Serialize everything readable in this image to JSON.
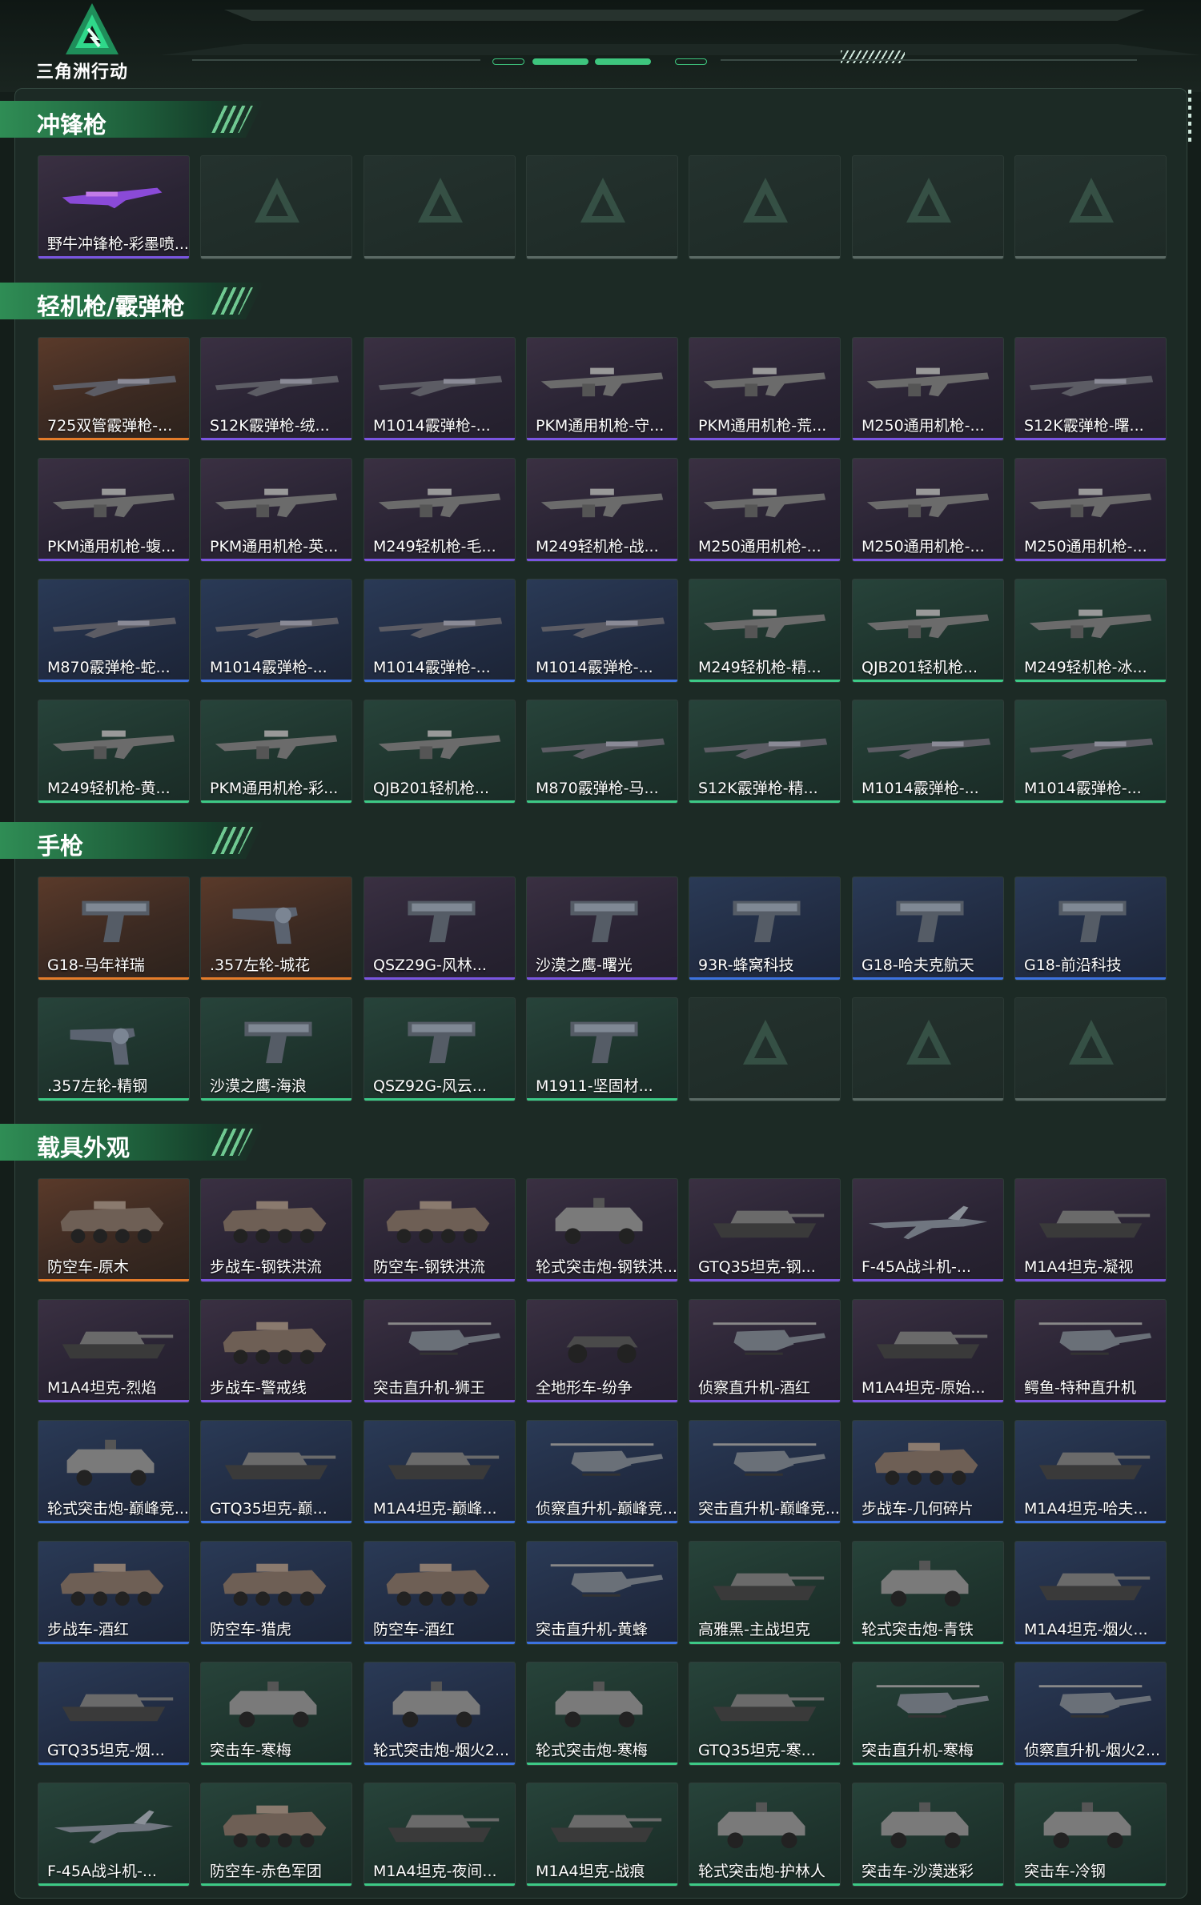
{
  "logo": {
    "text": "三角洲行动"
  },
  "sections": [
    {
      "title": "冲锋枪",
      "items": [
        {
          "label": "野牛冲锋枪-彩墨喷...",
          "rarity": "purple",
          "icon": "smg-icon"
        },
        {
          "label": "",
          "rarity": "empty"
        },
        {
          "label": "",
          "rarity": "empty"
        },
        {
          "label": "",
          "rarity": "empty"
        },
        {
          "label": "",
          "rarity": "empty"
        },
        {
          "label": "",
          "rarity": "empty"
        },
        {
          "label": "",
          "rarity": "empty"
        }
      ]
    },
    {
      "title": "轻机枪/霰弹枪",
      "items": [
        {
          "label": "725双管霰弹枪-...",
          "rarity": "orange",
          "icon": "shotgun-icon"
        },
        {
          "label": "S12K霰弹枪-绒...",
          "rarity": "purple",
          "icon": "shotgun-icon"
        },
        {
          "label": "M1014霰弹枪-...",
          "rarity": "purple",
          "icon": "shotgun-icon"
        },
        {
          "label": "PKM通用机枪-守...",
          "rarity": "purple",
          "icon": "lmg-icon"
        },
        {
          "label": "PKM通用机枪-荒...",
          "rarity": "purple",
          "icon": "lmg-icon"
        },
        {
          "label": "M250通用机枪-...",
          "rarity": "purple",
          "icon": "lmg-icon"
        },
        {
          "label": "S12K霰弹枪-曙...",
          "rarity": "purple",
          "icon": "shotgun-icon"
        },
        {
          "label": "PKM通用机枪-蝮...",
          "rarity": "purple",
          "icon": "lmg-icon"
        },
        {
          "label": "PKM通用机枪-英...",
          "rarity": "purple",
          "icon": "lmg-icon"
        },
        {
          "label": "M249轻机枪-毛...",
          "rarity": "purple",
          "icon": "lmg-icon"
        },
        {
          "label": "M249轻机枪-战...",
          "rarity": "purple",
          "icon": "lmg-icon"
        },
        {
          "label": "M250通用机枪-...",
          "rarity": "purple",
          "icon": "lmg-icon"
        },
        {
          "label": "M250通用机枪-...",
          "rarity": "purple",
          "icon": "lmg-icon"
        },
        {
          "label": "M250通用机枪-...",
          "rarity": "purple",
          "icon": "lmg-icon"
        },
        {
          "label": "M870霰弹枪-蛇...",
          "rarity": "blue",
          "icon": "shotgun-icon"
        },
        {
          "label": "M1014霰弹枪-...",
          "rarity": "blue",
          "icon": "shotgun-icon"
        },
        {
          "label": "M1014霰弹枪-...",
          "rarity": "blue",
          "icon": "shotgun-icon"
        },
        {
          "label": "M1014霰弹枪-...",
          "rarity": "blue",
          "icon": "shotgun-icon"
        },
        {
          "label": "M249轻机枪-精...",
          "rarity": "green",
          "icon": "lmg-icon"
        },
        {
          "label": "QJB201轻机枪...",
          "rarity": "green",
          "icon": "lmg-icon"
        },
        {
          "label": "M249轻机枪-冰...",
          "rarity": "green",
          "icon": "lmg-icon"
        },
        {
          "label": "M249轻机枪-黄...",
          "rarity": "green",
          "icon": "lmg-icon"
        },
        {
          "label": "PKM通用机枪-彩...",
          "rarity": "green",
          "icon": "lmg-icon"
        },
        {
          "label": "QJB201轻机枪...",
          "rarity": "green",
          "icon": "lmg-icon"
        },
        {
          "label": "M870霰弹枪-马...",
          "rarity": "green",
          "icon": "shotgun-icon"
        },
        {
          "label": "S12K霰弹枪-精...",
          "rarity": "green",
          "icon": "shotgun-icon"
        },
        {
          "label": "M1014霰弹枪-...",
          "rarity": "green",
          "icon": "shotgun-icon"
        },
        {
          "label": "M1014霰弹枪-...",
          "rarity": "green",
          "icon": "shotgun-icon"
        }
      ]
    },
    {
      "title": "手枪",
      "items": [
        {
          "label": "G18-马年祥瑞",
          "rarity": "orange",
          "icon": "pistol-icon"
        },
        {
          "label": ".357左轮-城花",
          "rarity": "orange",
          "icon": "revolver-icon"
        },
        {
          "label": "QSZ29G-风林...",
          "rarity": "purple",
          "icon": "pistol-icon"
        },
        {
          "label": "沙漠之鹰-曙光",
          "rarity": "purple",
          "icon": "pistol-icon"
        },
        {
          "label": "93R-蜂窝科技",
          "rarity": "blue",
          "icon": "pistol-icon"
        },
        {
          "label": "G18-哈夫克航天",
          "rarity": "blue",
          "icon": "pistol-icon"
        },
        {
          "label": "G18-前沿科技",
          "rarity": "blue",
          "icon": "pistol-icon"
        },
        {
          "label": ".357左轮-精钢",
          "rarity": "green",
          "icon": "revolver-icon"
        },
        {
          "label": "沙漠之鹰-海浪",
          "rarity": "green",
          "icon": "pistol-icon"
        },
        {
          "label": "QSZ92G-风云...",
          "rarity": "green",
          "icon": "pistol-icon"
        },
        {
          "label": "M1911-坚固材...",
          "rarity": "green",
          "icon": "pistol-icon"
        },
        {
          "label": "",
          "rarity": "empty"
        },
        {
          "label": "",
          "rarity": "empty"
        },
        {
          "label": "",
          "rarity": "empty"
        }
      ]
    },
    {
      "title": "载具外观",
      "items": [
        {
          "label": "防空车-原木",
          "rarity": "orange",
          "icon": "apc-icon"
        },
        {
          "label": "步战车-钢铁洪流",
          "rarity": "purple",
          "icon": "apc-icon"
        },
        {
          "label": "防空车-钢铁洪流",
          "rarity": "purple",
          "icon": "apc-icon"
        },
        {
          "label": "轮式突击炮-钢铁洪...",
          "rarity": "purple",
          "icon": "armored-car-icon"
        },
        {
          "label": "GTQ35坦克-钢...",
          "rarity": "purple",
          "icon": "tank-icon"
        },
        {
          "label": "F-45A战斗机-...",
          "rarity": "purple",
          "icon": "jet-icon"
        },
        {
          "label": "M1A4坦克-凝视",
          "rarity": "purple",
          "icon": "tank-icon"
        },
        {
          "label": "M1A4坦克-烈焰",
          "rarity": "purple",
          "icon": "tank-icon"
        },
        {
          "label": "步战车-警戒线",
          "rarity": "purple",
          "icon": "apc-icon"
        },
        {
          "label": "突击直升机-狮王",
          "rarity": "purple",
          "icon": "helicopter-icon"
        },
        {
          "label": "全地形车-纷争",
          "rarity": "purple",
          "icon": "atv-icon"
        },
        {
          "label": "侦察直升机-酒红",
          "rarity": "purple",
          "icon": "helicopter-icon"
        },
        {
          "label": "M1A4坦克-原始...",
          "rarity": "purple",
          "icon": "tank-icon"
        },
        {
          "label": "鳄鱼-特种直升机",
          "rarity": "purple",
          "icon": "helicopter-icon"
        },
        {
          "label": "轮式突击炮-巅峰竞...",
          "rarity": "blue",
          "icon": "armored-car-icon"
        },
        {
          "label": "GTQ35坦克-巅...",
          "rarity": "blue",
          "icon": "tank-icon"
        },
        {
          "label": "M1A4坦克-巅峰...",
          "rarity": "blue",
          "icon": "tank-icon"
        },
        {
          "label": "侦察直升机-巅峰竞...",
          "rarity": "blue",
          "icon": "helicopter-icon"
        },
        {
          "label": "突击直升机-巅峰竞...",
          "rarity": "blue",
          "icon": "helicopter-icon"
        },
        {
          "label": "步战车-几何碎片",
          "rarity": "blue",
          "icon": "apc-icon"
        },
        {
          "label": "M1A4坦克-哈夫...",
          "rarity": "blue",
          "icon": "tank-icon"
        },
        {
          "label": "步战车-酒红",
          "rarity": "blue",
          "icon": "apc-icon"
        },
        {
          "label": "防空车-猎虎",
          "rarity": "blue",
          "icon": "apc-icon"
        },
        {
          "label": "防空车-酒红",
          "rarity": "blue",
          "icon": "apc-icon"
        },
        {
          "label": "突击直升机-黄蜂",
          "rarity": "blue",
          "icon": "helicopter-icon"
        },
        {
          "label": "高雅黑-主战坦克",
          "rarity": "green",
          "icon": "tank-icon"
        },
        {
          "label": "轮式突击炮-青铁",
          "rarity": "green",
          "icon": "armored-car-icon"
        },
        {
          "label": "M1A4坦克-烟火...",
          "rarity": "blue",
          "icon": "tank-icon"
        },
        {
          "label": "GTQ35坦克-烟...",
          "rarity": "blue",
          "icon": "tank-icon"
        },
        {
          "label": "突击车-寒梅",
          "rarity": "green",
          "icon": "armored-car-icon"
        },
        {
          "label": "轮式突击炮-烟火2...",
          "rarity": "blue",
          "icon": "armored-car-icon"
        },
        {
          "label": "轮式突击炮-寒梅",
          "rarity": "green",
          "icon": "armored-car-icon"
        },
        {
          "label": "GTQ35坦克-寒...",
          "rarity": "green",
          "icon": "tank-icon"
        },
        {
          "label": "突击直升机-寒梅",
          "rarity": "green",
          "icon": "helicopter-icon"
        },
        {
          "label": "侦察直升机-烟火2...",
          "rarity": "blue",
          "icon": "helicopter-icon"
        },
        {
          "label": "F-45A战斗机-...",
          "rarity": "green",
          "icon": "jet-icon"
        },
        {
          "label": "防空车-赤色军团",
          "rarity": "green",
          "icon": "apc-icon"
        },
        {
          "label": "M1A4坦克-夜间...",
          "rarity": "green",
          "icon": "tank-icon"
        },
        {
          "label": "M1A4坦克-战痕",
          "rarity": "green",
          "icon": "tank-icon"
        },
        {
          "label": "轮式突击炮-护林人",
          "rarity": "green",
          "icon": "armored-car-icon"
        },
        {
          "label": "突击车-沙漠迷彩",
          "rarity": "green",
          "icon": "armored-car-icon"
        },
        {
          "label": "突击车-冷钢",
          "rarity": "green",
          "icon": "armored-car-icon"
        }
      ]
    }
  ],
  "colors": {
    "orange": "#e57c2a",
    "purple": "#7a55e0",
    "blue": "#3c72e0",
    "green": "#3dc986",
    "accent": "#2f8d55"
  }
}
